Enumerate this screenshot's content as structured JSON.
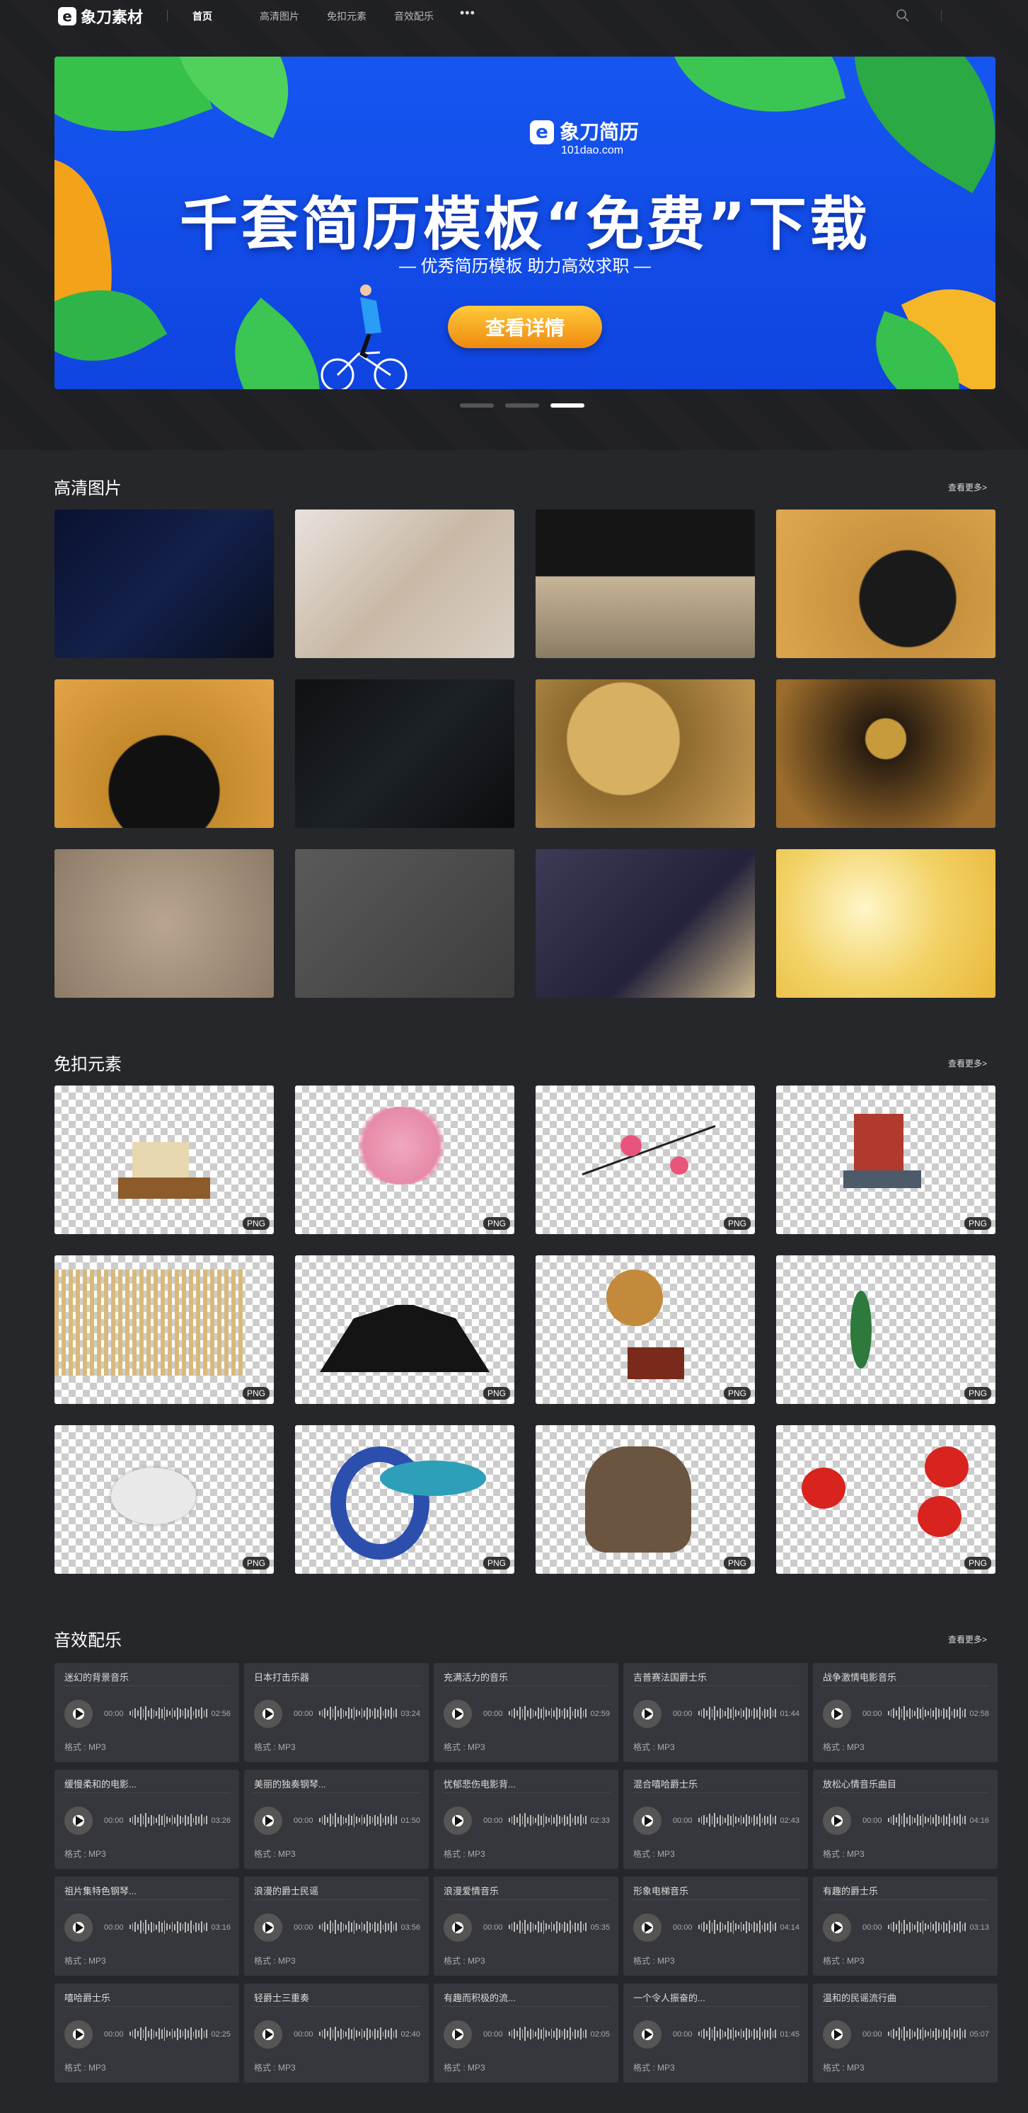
{
  "nav": {
    "logo": "象刀素材",
    "items": [
      "首页",
      "高清图片",
      "免扣元素",
      "音效配乐"
    ],
    "more": "•••"
  },
  "banner": {
    "brand": "象刀简历",
    "url": "101dao.com",
    "title": "千套简历模板“免费”下载",
    "subtitle": "— 优秀简历模板  助力高效求职 —",
    "button": "查看详情",
    "slides": 3,
    "active_slide": 3
  },
  "photos": {
    "title": "高清图片",
    "more": "查看更多>"
  },
  "elements": {
    "title": "免扣元素",
    "more": "查看更多>",
    "badge": "PNG"
  },
  "music": {
    "title": "音效配乐",
    "more": "查看更多>",
    "start": "00:00",
    "format": "格式 : MP3",
    "tracks": [
      {
        "t": "迷幻的背景音乐",
        "d": "02:56"
      },
      {
        "t": "日本打击乐器",
        "d": "03:24"
      },
      {
        "t": "充满活力的音乐",
        "d": "02:59"
      },
      {
        "t": "吉普赛法国爵士乐",
        "d": "01:44"
      },
      {
        "t": "战争激情电影音乐",
        "d": "02:58"
      },
      {
        "t": "缓慢柔和的电影...",
        "d": "03:26"
      },
      {
        "t": "美丽的独奏钢琴...",
        "d": "01:50"
      },
      {
        "t": "忧郁悲伤电影背...",
        "d": "02:33"
      },
      {
        "t": "混合嘻哈爵士乐",
        "d": "02:43"
      },
      {
        "t": "放松心情音乐曲目",
        "d": "04:16"
      },
      {
        "t": "祖片集特色钢琴...",
        "d": "03:16"
      },
      {
        "t": "浪漫的爵士民谣",
        "d": "03:56"
      },
      {
        "t": "浪漫爱情音乐",
        "d": "05:35"
      },
      {
        "t": "形象电梯音乐",
        "d": "04:14"
      },
      {
        "t": "有趣的爵士乐",
        "d": "03:13"
      },
      {
        "t": "嘻哈爵士乐",
        "d": "02:25"
      },
      {
        "t": "轻爵士三重奏",
        "d": "02:40"
      },
      {
        "t": "有趣而积极的流...",
        "d": "02:05"
      },
      {
        "t": "一个令人振奋的...",
        "d": "01:45"
      },
      {
        "t": "温和的民谣流行曲",
        "d": "05:07"
      }
    ]
  }
}
